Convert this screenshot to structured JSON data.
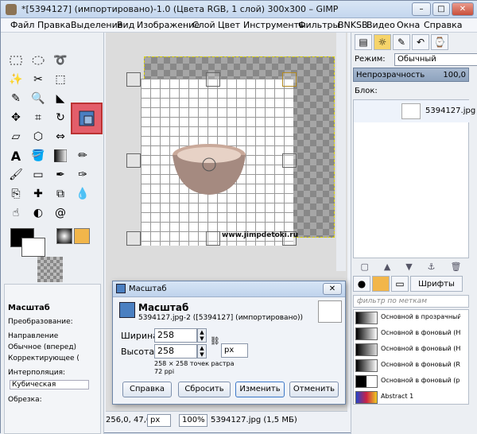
{
  "window": {
    "title": "*[5394127] (импортировано)-1.0 (Цвета RGB, 1 слой) 300x300 – GIMP",
    "minimize_label": "–",
    "maximize_label": "□",
    "close_label": "✕"
  },
  "menubar": [
    "Файл",
    "Правка",
    "Выделение",
    "Вид",
    "Изображение",
    "Слой",
    "Цвет",
    "Инструменты",
    "Фильтры",
    "BNKSB",
    "Видео",
    "Окна",
    "Справка"
  ],
  "toolbox": {
    "tools": [
      "rect-select",
      "ellipse-select",
      "lasso",
      "fuzzy-select",
      "select-by-color",
      "scissors",
      "foreground-select",
      "paths",
      "color-picker",
      "zoom",
      "measure",
      "move",
      "align",
      "crop",
      "rotate",
      "scale",
      "shear",
      "perspective",
      "flip",
      "text",
      "bucket-fill",
      "blend",
      "pencil",
      "paintbrush",
      "eraser",
      "airbrush",
      "ink",
      "clone",
      "heal",
      "perspective-clone",
      "blur",
      "smudge",
      "dodge"
    ],
    "active_tool": "scale"
  },
  "tool_options": {
    "title": "Масштаб",
    "transform_label": "Преобразование:",
    "direction_label": "Направление",
    "direction_opt1": "Обычное (вперед)",
    "direction_opt2": "Корректирующее (",
    "interp_label": "Интерполяция:",
    "interp_value": "Кубическая",
    "clip_label": "Обрезка:"
  },
  "canvas": {
    "watermark": "www.jimpdetoki.ru"
  },
  "statusbar": {
    "coords": "256,0, 47,0",
    "unit": "px",
    "zoom": "100%",
    "file_info": "5394127.jpg (1,5 МБ)"
  },
  "layers": {
    "mode_label": "Режим:",
    "mode_value": "Обычный",
    "opacity_label": "Непрозрачность",
    "opacity_value": "100,0",
    "lock_label": "Блок:",
    "layer_name": "5394127.jpg"
  },
  "gradients": {
    "fonts_tab": "Шрифты",
    "filter_placeholder": "фильтр по меткам",
    "items": [
      {
        "name": "Основной в прозрачный"
      },
      {
        "name": "Основной в фоновый (HSV"
      },
      {
        "name": "Основной в фоновый (HSV"
      },
      {
        "name": "Основной в фоновый (RGB)"
      },
      {
        "name": "Основной в фоновый (резк"
      },
      {
        "name": "Abstract 1"
      }
    ]
  },
  "dialog": {
    "title": "Масштаб",
    "heading": "Масштаб",
    "subtitle": "5394127.jpg-2 ([5394127] (импортировано))",
    "width_label": "Ширина:",
    "width_value": "258",
    "height_label": "Высота:",
    "height_value": "258",
    "unit": "px",
    "info1": "258 × 258 точек растра",
    "info2": "72 ppi",
    "btn_help": "Справка",
    "btn_reset": "Сбросить",
    "btn_scale": "Изменить",
    "btn_cancel": "Отменить"
  }
}
